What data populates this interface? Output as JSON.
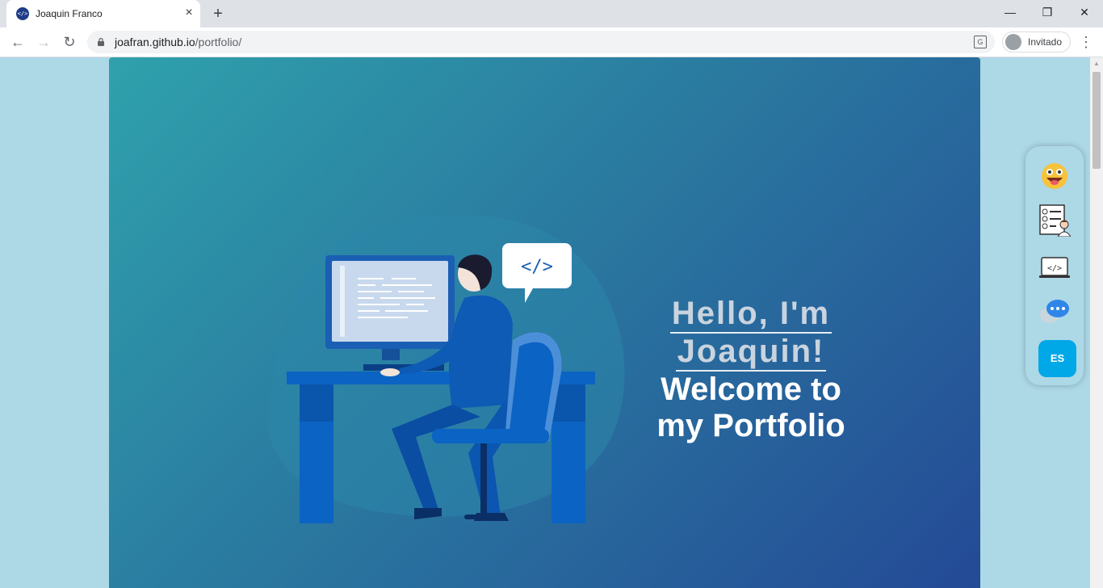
{
  "browser": {
    "tab_title": "Joaquin Franco",
    "favicon_text": "</>",
    "url_host": "joafran.github.io",
    "url_path": "/portfolio/",
    "profile_label": "Invitado"
  },
  "hero": {
    "hello_line1": "Hello, I'm",
    "hello_line2": "Joaquin!",
    "welcome_line1": "Welcome to",
    "welcome_line2": "my Portfolio",
    "speech_bubble_text": "</>"
  },
  "sidenav": {
    "items": [
      {
        "icon": "smiley-face-icon"
      },
      {
        "icon": "resume-document-icon"
      },
      {
        "icon": "laptop-code-icon"
      },
      {
        "icon": "chat-bubbles-icon"
      }
    ],
    "language_button": "ES"
  },
  "colors": {
    "page_bg": "#add8e6",
    "hero_gradient_start": "#2fa1ac",
    "hero_gradient_end": "#244a96",
    "accent": "#00a8e8"
  }
}
